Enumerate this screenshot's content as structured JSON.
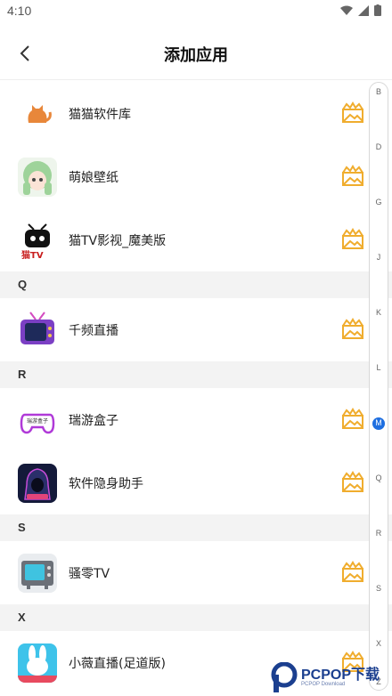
{
  "status_bar": {
    "time": "4:10"
  },
  "header": {
    "title": "添加应用"
  },
  "apps_group_0": [
    {
      "name": "猫猫软件库",
      "icon": "cat-silhouette-icon"
    },
    {
      "name": "萌娘壁纸",
      "icon": "anime-girl-icon"
    },
    {
      "name": "猫TV影视_魔美版",
      "icon": "cat-tv-logo-icon",
      "icon_text": "猫TV"
    }
  ],
  "section_q": {
    "letter": "Q",
    "apps": [
      {
        "name": "千频直播",
        "icon": "retro-tv-icon"
      }
    ]
  },
  "section_r": {
    "letter": "R",
    "apps": [
      {
        "name": "瑞游盒子",
        "icon": "gamepad-icon",
        "icon_text": "瑞游盒子"
      },
      {
        "name": "软件隐身助手",
        "icon": "hooded-figure-icon"
      }
    ]
  },
  "section_s": {
    "letter": "S",
    "apps": [
      {
        "name": "骚零TV",
        "icon": "tv-set-icon"
      }
    ]
  },
  "section_x": {
    "letter": "X",
    "apps": [
      {
        "name": "小薇直播(足道版)",
        "icon": "rabbit-icon"
      }
    ]
  },
  "index_bar": {
    "letters": [
      "B",
      "D",
      "G",
      "J",
      "K",
      "L",
      "M",
      "Q",
      "R",
      "S",
      "X",
      "Z"
    ],
    "active": "M"
  },
  "watermark": {
    "text": "PCPOP下载",
    "sub": "PCPOP Download"
  },
  "colors": {
    "add_icon": "#f0ad2e",
    "index_active": "#1f6fe0",
    "section_bg": "#f3f3f3"
  }
}
